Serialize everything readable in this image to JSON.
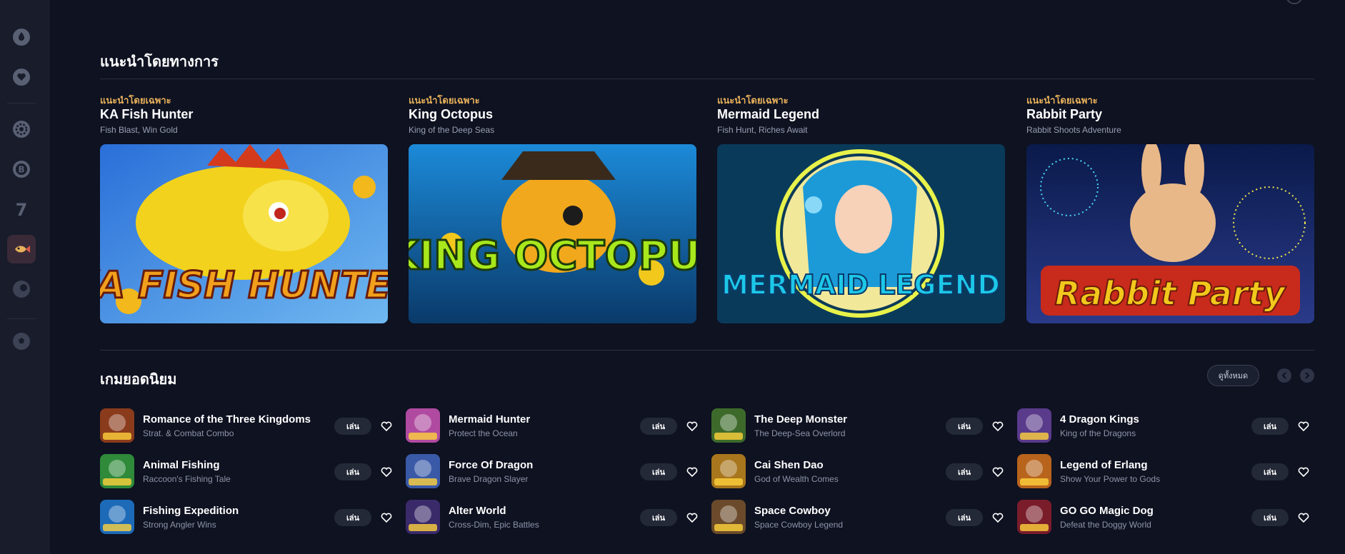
{
  "sidebar": {
    "icons": [
      {
        "name": "drop-icon"
      },
      {
        "name": "heart-icon"
      },
      {
        "name": "poker-chip-icon"
      },
      {
        "name": "bitcoin-icon"
      },
      {
        "name": "seven-slot-icon"
      },
      {
        "name": "fish-icon",
        "active": true
      },
      {
        "name": "pokeball-icon"
      },
      {
        "name": "soccer-ball-icon"
      }
    ]
  },
  "recommended": {
    "title": "แนะนำโดยทางการ",
    "cards": [
      {
        "tag": "แนะนำโดยเฉพาะ",
        "title": "KA Fish Hunter",
        "subtitle": "Fish Blast, Win Gold",
        "art_text": "KA FISH HUNTER"
      },
      {
        "tag": "แนะนำโดยเฉพาะ",
        "title": "King Octopus",
        "subtitle": "King of the Deep Seas",
        "art_text": "KING OCTOPUS"
      },
      {
        "tag": "แนะนำโดยเฉพาะ",
        "title": "Mermaid Legend",
        "subtitle": "Fish Hunt, Riches Await",
        "art_text": "MERMAID LEGEND"
      },
      {
        "tag": "แนะนำโดยเฉพาะ",
        "title": "Rabbit Party",
        "subtitle": "Rabbit Shoots Adventure",
        "art_text": "Rabbit Party"
      }
    ]
  },
  "popular": {
    "title": "เกมยอดนิยม",
    "view_all": "ดูทั้งหมด",
    "play_label": "เล่น",
    "games": [
      {
        "name": "Romance of the Three Kingdoms",
        "desc": "Strat. & Combat Combo",
        "color": "#8a3b1c"
      },
      {
        "name": "Mermaid Hunter",
        "desc": "Protect the Ocean",
        "color": "#b04aa0"
      },
      {
        "name": "The Deep Monster",
        "desc": "The Deep-Sea Overlord",
        "color": "#3d6a2a"
      },
      {
        "name": "4 Dragon Kings",
        "desc": "King of the Dragons",
        "color": "#5a3a8a"
      },
      {
        "name": "Animal Fishing",
        "desc": "Raccoon's Fishing Tale",
        "color": "#2f8a3a"
      },
      {
        "name": "Force Of Dragon",
        "desc": "Brave Dragon Slayer",
        "color": "#3a5aa8"
      },
      {
        "name": "Cai Shen Dao",
        "desc": "God of Wealth Comes",
        "color": "#a8761c"
      },
      {
        "name": "Legend of Erlang",
        "desc": "Show Your Power to Gods",
        "color": "#b8641c"
      },
      {
        "name": "Fishing Expedition",
        "desc": "Strong Angler Wins",
        "color": "#1c6ab8"
      },
      {
        "name": "Alter World",
        "desc": "Cross-Dim, Epic Battles",
        "color": "#3a2a6a"
      },
      {
        "name": "Space Cowboy",
        "desc": "Space Cowboy Legend",
        "color": "#6a4a2a"
      },
      {
        "name": "GO GO Magic Dog",
        "desc": "Defeat the Doggy World",
        "color": "#7a1c2a"
      }
    ]
  }
}
